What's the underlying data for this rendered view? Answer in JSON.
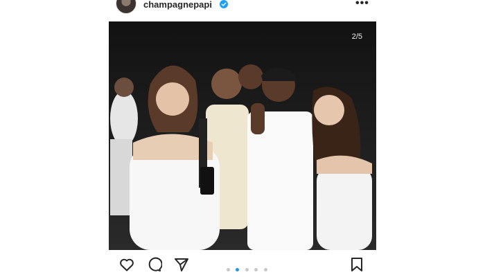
{
  "post": {
    "username": "champagnepapi",
    "verified": true,
    "slide_counter": "2/5",
    "current_slide": 2,
    "total_slides": 5
  },
  "icons": {
    "more": "more-options-icon",
    "like": "heart-icon",
    "comment": "comment-icon",
    "share": "send-icon",
    "save": "bookmark-icon"
  },
  "colors": {
    "verified_badge": "#1da1f2",
    "active_dot": "#2a93e8",
    "inactive_dot": "#c8c8c8"
  }
}
